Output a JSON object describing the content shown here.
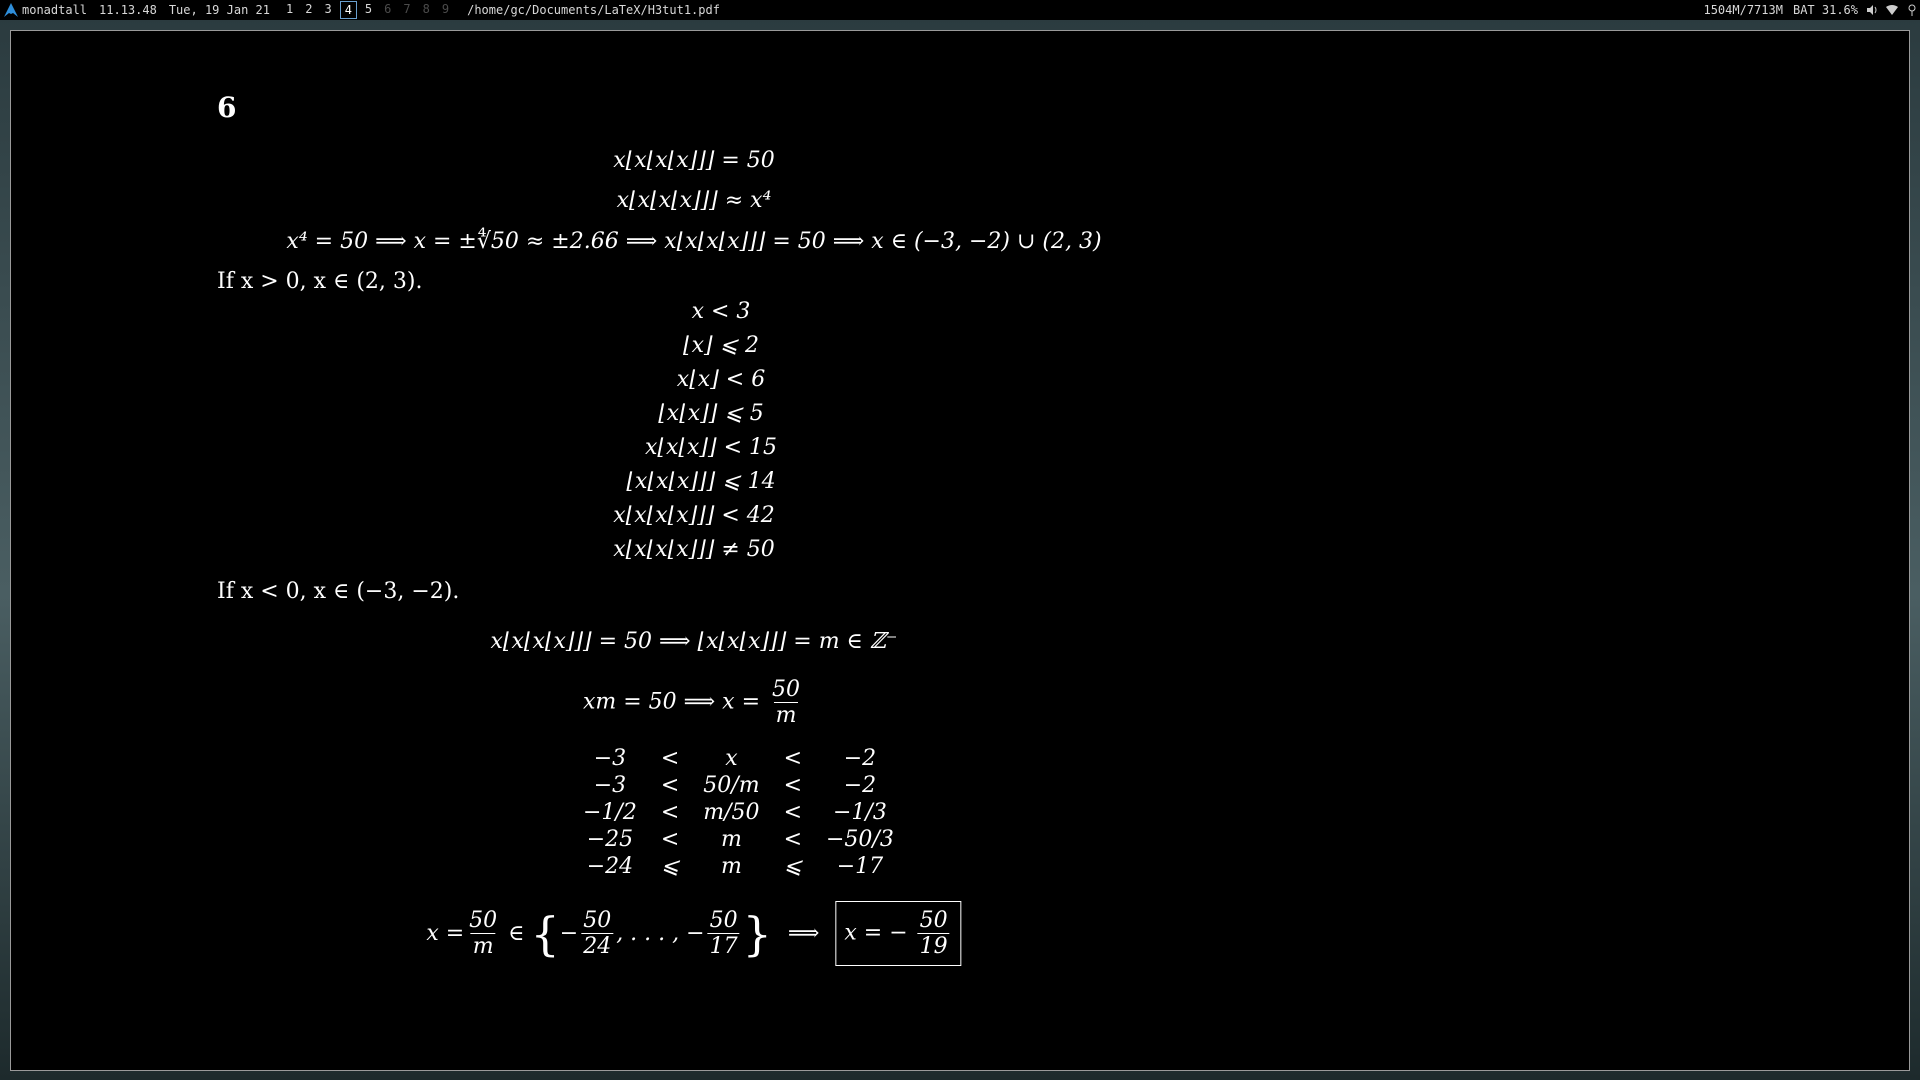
{
  "topbar": {
    "layout_name": "monadtall",
    "time": "11.13.48",
    "date": "Tue, 19 Jan 21",
    "groups": [
      {
        "label": "1",
        "state": "used"
      },
      {
        "label": "2",
        "state": "used"
      },
      {
        "label": "3",
        "state": "used"
      },
      {
        "label": "4",
        "state": "active"
      },
      {
        "label": "5",
        "state": "used"
      },
      {
        "label": "6",
        "state": "empty"
      },
      {
        "label": "7",
        "state": "empty"
      },
      {
        "label": "8",
        "state": "empty"
      },
      {
        "label": "9",
        "state": "empty"
      }
    ],
    "window_title": "/home/gc/Documents/LaTeX/H3tut1.pdf",
    "memory": "1504M/7713M",
    "battery": "BAT 31.6%",
    "icons": [
      "arch-logo-icon",
      "volume-icon",
      "wifi-icon",
      "pin-icon"
    ]
  },
  "document": {
    "section": "6",
    "eq1": "x⌊x⌊x⌊x⌋⌋⌋ = 50",
    "eq2": "x⌊x⌊x⌊x⌋⌋⌋ ≈ x⁴",
    "eq3": "x⁴ = 50  ⟹  x = ±∜50 ≈ ±2.66  ⟹  x⌊x⌊x⌊x⌋⌋⌋ = 50  ⟹  x ∈ (−3, −2) ∪ (2, 3)",
    "case1": "If x > 0, x ∈ (2, 3).",
    "chain1": [
      "x < 3",
      "⌊x⌋ ⩽ 2",
      "x⌊x⌋ < 6",
      "⌊x⌊x⌋⌋ ⩽ 5",
      "x⌊x⌊x⌋⌋ < 15",
      "⌊x⌊x⌊x⌋⌋⌋ ⩽ 14",
      "x⌊x⌊x⌊x⌋⌋⌋ < 42",
      "x⌊x⌊x⌊x⌋⌋⌋ ≠ 50"
    ],
    "case2": "If x < 0, x ∈ (−3, −2).",
    "eq4": "x⌊x⌊x⌊x⌋⌋⌋ = 50  ⟹  ⌊x⌊x⌊x⌋⌋⌋ = m ∈ ℤ⁻",
    "eq5_left": "xm = 50  ⟹  x =",
    "eq5_num": "50",
    "eq5_den": "m",
    "table": [
      [
        "−3",
        "<",
        "x",
        "<",
        "−2"
      ],
      [
        "−3",
        "<",
        "50/m",
        "<",
        "−2"
      ],
      [
        "−1/2",
        "<",
        "m/50",
        "<",
        "−1/3"
      ],
      [
        "−25",
        "<",
        "m",
        "<",
        "−50/3"
      ],
      [
        "−24",
        "⩽",
        "m",
        "⩽",
        "−17"
      ]
    ],
    "final_x": "x =",
    "final_num": "50",
    "final_den": "m",
    "final_in": "∈",
    "set_open": "{",
    "set_first_neg": "−",
    "set_first_num": "50",
    "set_first_den": "24",
    "set_dots": ", . . . , −",
    "set_last_num": "50",
    "set_last_den": "17",
    "set_close": "}",
    "implies": "⟹",
    "answer_left": "x = −",
    "answer_num": "50",
    "answer_den": "19"
  }
}
